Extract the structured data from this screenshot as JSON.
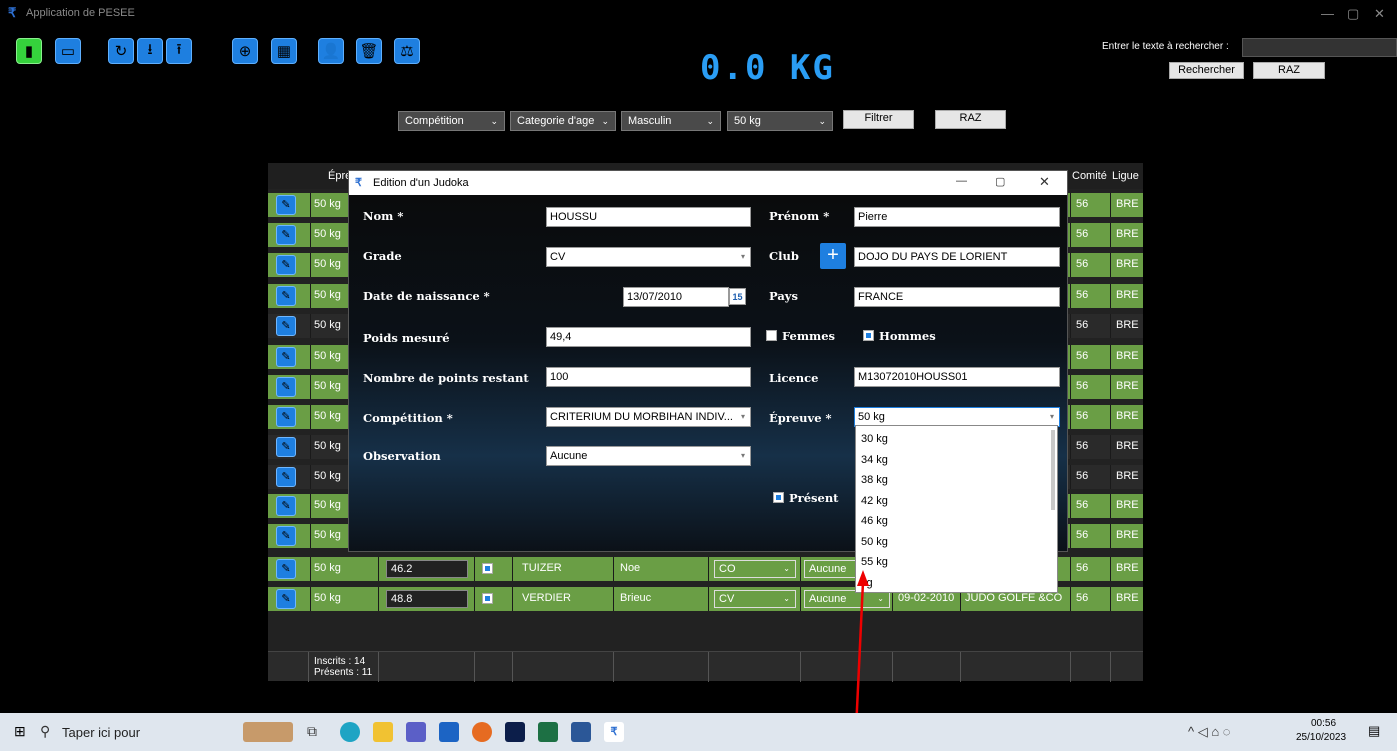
{
  "app": {
    "title": "Application de PESEE",
    "weight": "0.0 KG"
  },
  "search": {
    "label": "Entrer le texte à rechercher :",
    "value": "",
    "search_btn": "Rechercher",
    "reset_btn": "RAZ"
  },
  "filters": {
    "competition": "Compétition",
    "age": "Categorie d'age",
    "sex": "Masculin",
    "weight": "50 kg",
    "filter_btn": "Filtrer",
    "reset_btn": "RAZ"
  },
  "grid": {
    "col_epreuve": "Épreuve",
    "col_comite": "Comité",
    "col_ligue": "Ligue",
    "rows": [
      {
        "epreuve": "50 kg",
        "comite": "56",
        "ligue": "BRE"
      },
      {
        "epreuve": "50 kg",
        "comite": "56",
        "ligue": "BRE"
      },
      {
        "epreuve": "50 kg",
        "comite": "56",
        "ligue": "BRE"
      },
      {
        "epreuve": "50 kg",
        "comite": "56",
        "ligue": "BRE"
      },
      {
        "epreuve": "50 kg",
        "comite": "56",
        "ligue": "BRE"
      },
      {
        "epreuve": "50 kg",
        "comite": "56",
        "ligue": "BRE"
      },
      {
        "epreuve": "50 kg",
        "comite": "56",
        "ligue": "BRE"
      },
      {
        "epreuve": "50 kg",
        "comite": "56",
        "ligue": "BRE"
      },
      {
        "epreuve": "50 kg",
        "comite": "56",
        "ligue": "BRE"
      },
      {
        "epreuve": "50 kg",
        "comite": "56",
        "ligue": "BRE"
      },
      {
        "epreuve": "50 kg",
        "comite": "56",
        "ligue": "BRE"
      },
      {
        "epreuve": "50 kg",
        "comite": "56",
        "ligue": "BRE"
      },
      {
        "epreuve": "50 kg",
        "poids": "46.2",
        "nom": "TUIZER",
        "prenom": "Noe",
        "grade": "CO",
        "obs": "Aucune",
        "comite": "56",
        "ligue": "BRE"
      },
      {
        "epreuve": "50 kg",
        "poids": "48.8",
        "nom": "VERDIER",
        "prenom": "Brieuc",
        "grade": "CV",
        "obs": "Aucune",
        "naissance": "09-02-2010",
        "club": "JUDO GOLFE &CO",
        "comite": "56",
        "ligue": "BRE"
      }
    ],
    "inscrits": "Inscrits : 14",
    "presents": "Présents : 11"
  },
  "dialog": {
    "title": "Edition d'un Judoka",
    "nom_label": "Nom *",
    "nom": "HOUSSU",
    "prenom_label": "Prénom *",
    "prenom": "Pierre",
    "grade_label": "Grade",
    "grade": "CV",
    "club_label": "Club",
    "club": "DOJO DU PAYS DE LORIENT",
    "naissance_label": "Date de naissance *",
    "naissance": "13/07/2010",
    "cal": "15",
    "pays_label": "Pays",
    "pays": "FRANCE",
    "poids_label": "Poids mesuré",
    "poids": "49,4",
    "femmes": "Femmes",
    "hommes": "Hommes",
    "points_label": "Nombre de points restant",
    "points": "100",
    "licence_label": "Licence",
    "licence": "M13072010HOUSS01",
    "competition_label": "Compétition *",
    "competition": "CRITERIUM DU MORBIHAN INDIV...",
    "epreuve_label": "Épreuve *",
    "epreuve": "50 kg",
    "observation_label": "Observation",
    "observation": "Aucune",
    "present": "Présent",
    "epreuve_options": [
      "30 kg",
      "34 kg",
      "38 kg",
      "42 kg",
      "46 kg",
      "50 kg",
      "55 kg",
      "kg"
    ]
  },
  "taskbar": {
    "search": "Taper ici pour",
    "time": "00:56",
    "date": "25/10/2023"
  }
}
